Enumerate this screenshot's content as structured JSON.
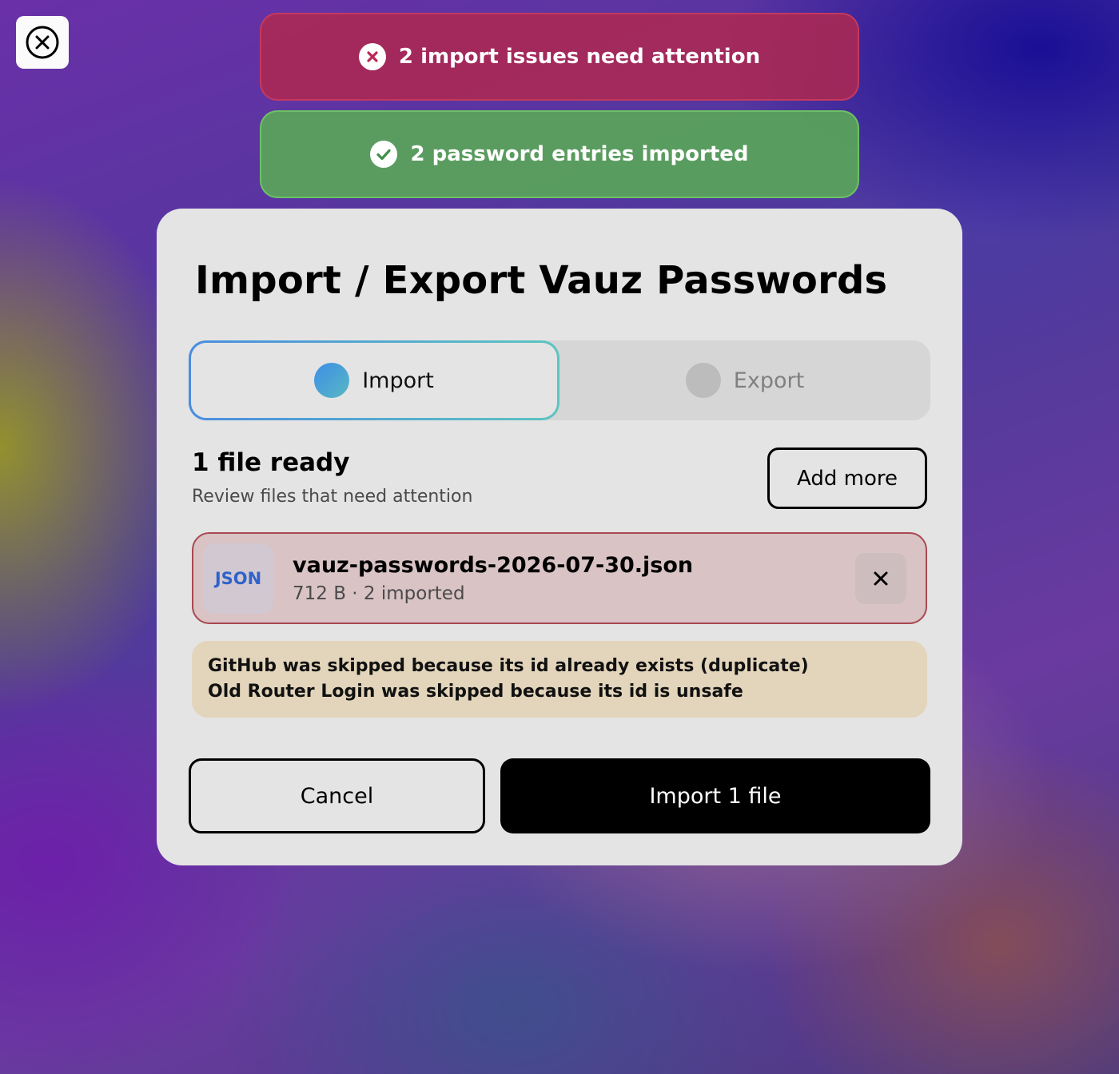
{
  "close_button": {
    "icon": "close-circle-icon"
  },
  "toasts": {
    "error": {
      "icon": "error-x-icon",
      "text": "2 import issues need attention"
    },
    "success": {
      "icon": "checkmark-icon",
      "text": "2 password entries imported"
    }
  },
  "modal": {
    "title": "Import / Export Vauz Passwords",
    "tabs": [
      {
        "label": "Import",
        "selected": true
      },
      {
        "label": "Export",
        "selected": false
      }
    ],
    "files": {
      "heading": "1 file ready",
      "subtitle": "Review files that need attention",
      "add_more_label": "Add more",
      "items": [
        {
          "badge": "JSON",
          "name": "vauz-passwords-2026-07-30.json",
          "meta": "712 B · 2 imported",
          "status": "error"
        }
      ]
    },
    "issues": [
      "GitHub was skipped because its id already exists (duplicate)",
      "Old Router Login was skipped because its id is unsafe"
    ],
    "actions": {
      "cancel_label": "Cancel",
      "primary_label": "Import 1 file"
    }
  },
  "colors": {
    "error_toast": "#af2850",
    "success_toast": "#5aa55a",
    "file_card_error_bg": "#d9c3c5",
    "file_card_error_border": "#a84850",
    "issues_bg": "#e3d5bb",
    "json_badge_text": "#2f63c9",
    "import_tab_gradient_start": "#4a8de0",
    "import_tab_gradient_end": "#5ec4c0"
  }
}
